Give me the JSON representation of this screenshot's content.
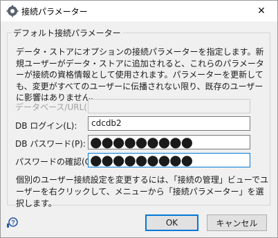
{
  "window": {
    "title": "接続パラメーター",
    "close_glyph": "✕"
  },
  "group": {
    "legend": "デフォルト接続パラメーター",
    "description": "データ・ストアにオプションの接続パラメーターを指定します。新規ユーザーがデータ・ストアに追加されると、これらのパラメーターが接続の資格情報として使用されます。パラメーターを更新しても、変更がすべてのユーザーに伝播されない限り、既存のユーザーに影響はありません。"
  },
  "fields": {
    "database_url": {
      "label": "データベース/URL(D):",
      "value": "",
      "disabled": true
    },
    "db_login": {
      "label": "DB ログイン(L):",
      "value": "cdcdb2"
    },
    "db_password": {
      "label": "DB パスワード(P):",
      "value": "●●●●●●●●●"
    },
    "password_confirm": {
      "label": "パスワードの確認(C):",
      "value": "●●●●●●●●●"
    }
  },
  "note": "個別のユーザー接続設定を変更するには、「接続の管理」ビューでユーザーを右クリックして、メニューから「接続パラメーター」を選択します。",
  "buttons": {
    "ok": "OK",
    "cancel": "キャンセル"
  },
  "icons": {
    "title": "app-gear-icon",
    "help": "help-icon"
  },
  "colors": {
    "focus": "#0078d7",
    "dialog_bg": "#f0f0f0"
  }
}
